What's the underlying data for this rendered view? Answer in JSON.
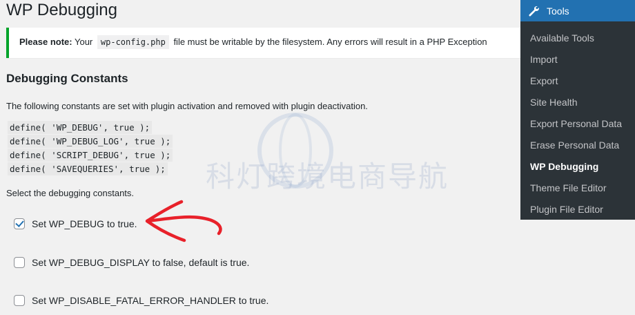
{
  "page": {
    "title": "WP Debugging"
  },
  "notice": {
    "prefix": "Please note:",
    "text_before": "Your",
    "code": "wp-config.php",
    "text_after": "file must be writable by the filesystem. Any errors will result in a PHP Exception"
  },
  "section": {
    "title": "Debugging Constants",
    "description": "The following constants are set with plugin activation and removed with plugin deactivation.",
    "code_lines": [
      "define( 'WP_DEBUG', true );",
      "define( 'WP_DEBUG_LOG', true );",
      "define( 'SCRIPT_DEBUG', true );",
      "define( 'SAVEQUERIES', true );"
    ],
    "select_label": "Select the debugging constants."
  },
  "options": [
    {
      "label": "Set WP_DEBUG to true.",
      "checked": true
    },
    {
      "label": "Set WP_DEBUG_DISPLAY to false, default is true.",
      "checked": false
    },
    {
      "label": "Set WP_DISABLE_FATAL_ERROR_HANDLER to true.",
      "checked": false
    }
  ],
  "watermark": {
    "text": "科灯跨境电商导航"
  },
  "menu": {
    "title": "Tools",
    "icon": "wrench-icon",
    "items": [
      "Available Tools",
      "Import",
      "Export",
      "Site Health",
      "Export Personal Data",
      "Erase Personal Data",
      "WP Debugging",
      "Theme File Editor",
      "Plugin File Editor"
    ],
    "active_index": 6
  },
  "colors": {
    "notice_border": "#00a32a",
    "menu_bg": "#2c3338",
    "menu_head": "#2271b1",
    "annotation_arrow": "#e8212a"
  }
}
